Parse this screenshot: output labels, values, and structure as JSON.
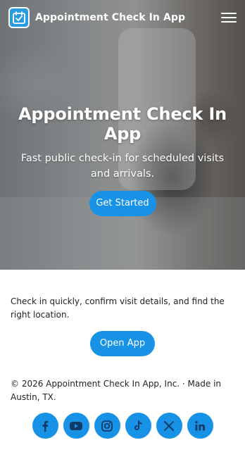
{
  "nav": {
    "brand": "Appointment Check In App",
    "logo_icon": "calendar-check-icon",
    "menu_icon": "hamburger-menu-icon"
  },
  "hero": {
    "title": "Appointment Check In App",
    "subtitle": "Fast public check-in for scheduled visits and arrivals.",
    "cta_label": "Get Started"
  },
  "intro": {
    "text": "Check in quickly, confirm visit details, and find the right location.",
    "button_label": "Open App"
  },
  "footer": {
    "copyright": "© 2026 Appointment Check In App, Inc. · Made in Austin, TX.",
    "social": [
      {
        "icon": "facebook-icon"
      },
      {
        "icon": "youtube-icon"
      },
      {
        "icon": "instagram-icon"
      },
      {
        "icon": "tiktok-icon"
      },
      {
        "icon": "x-icon"
      },
      {
        "icon": "linkedin-icon"
      }
    ]
  },
  "colors": {
    "accent": "#1792e6",
    "icon_fg": "#123a66"
  }
}
